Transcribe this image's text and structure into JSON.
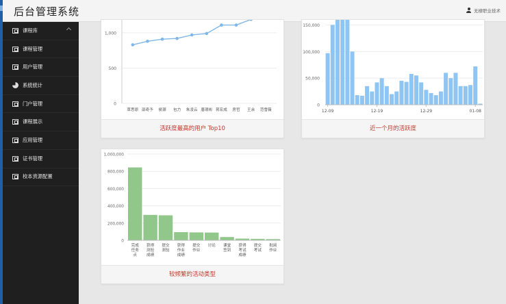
{
  "header": {
    "brand": "后台管理系统",
    "user": "无棣职业技术"
  },
  "sidebar": {
    "items": [
      {
        "label": "课程库",
        "icon": "grid-icon",
        "expand": true
      },
      {
        "label": "课程管理",
        "icon": "grid-icon"
      },
      {
        "label": "用户管理",
        "icon": "grid-icon"
      },
      {
        "label": "系统统计",
        "icon": "pie-chart-icon"
      },
      {
        "label": "门户管理",
        "icon": "grid-icon"
      },
      {
        "label": "课程展示",
        "icon": "grid-icon"
      },
      {
        "label": "应用管理",
        "icon": "grid-icon"
      },
      {
        "label": "证书管理",
        "icon": "grid-icon"
      },
      {
        "label": "校本资源配置",
        "icon": "grid-icon"
      }
    ]
  },
  "colors": {
    "line": "#7fb8e8",
    "bar_blue": "#8ec5f3",
    "bar_green": "#92c78b",
    "footer_text": "#c0392b"
  },
  "chart_data": [
    {
      "type": "line",
      "footer": "活跃度最高的用户 Top10",
      "categories": [
        "草思原",
        "邵奇予",
        "侯灏",
        "包力",
        "朱凌云",
        "唐璟彬",
        "蒋宏成",
        "房哲",
        "王余",
        "范雪薇"
      ],
      "values": [
        830,
        880,
        910,
        920,
        970,
        990,
        1110,
        1110,
        1190,
        1240
      ],
      "yticks": [
        "0",
        "500",
        "1,000"
      ],
      "ylim": [
        0,
        1300
      ]
    },
    {
      "type": "bar",
      "footer": "近一个月的活跃度",
      "xticks": [
        "12-09",
        "12-19",
        "12-29",
        "01-08"
      ],
      "values": [
        97000,
        150000,
        175000,
        172000,
        163000,
        100000,
        18000,
        17000,
        35000,
        25000,
        42000,
        50000,
        35000,
        20000,
        25000,
        45000,
        43000,
        58000,
        55000,
        42000,
        28000,
        22000,
        18000,
        25000,
        60000,
        50000,
        60000,
        35000,
        35000,
        37000,
        72000,
        2000
      ],
      "yticks": [
        "0",
        "50,000",
        "100,000",
        "150,000"
      ],
      "ylim": [
        0,
        175000
      ]
    },
    {
      "type": "bar",
      "footer": "较频繁的活动类型",
      "categories": [
        "完成\n任务\n点",
        "获得\n测验\n成绩",
        "提交\n测验",
        "获得\n作业\n成绩",
        "提交\n作业",
        "讨论",
        "课堂\n签到",
        "获得\n考试\n成绩",
        "提交\n考试",
        "批阅\n作业"
      ],
      "values": [
        845000,
        295000,
        290000,
        95000,
        92000,
        90000,
        38000,
        20000,
        17000,
        14000
      ],
      "yticks": [
        "0",
        "200,000",
        "400,000",
        "600,000",
        "800,000",
        "1,000,000"
      ],
      "ylim": [
        0,
        1000000
      ]
    }
  ]
}
